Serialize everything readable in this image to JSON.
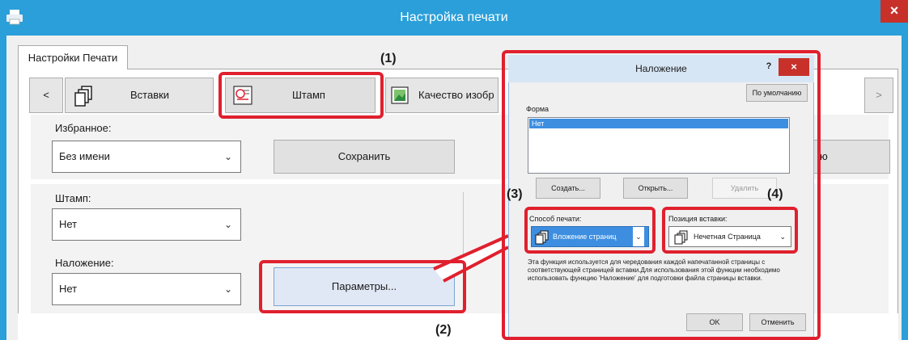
{
  "window": {
    "title": "Настройка печати",
    "close": "×"
  },
  "tab": {
    "label": "Настройки Печати"
  },
  "strip": {
    "prev": "<",
    "next": ">",
    "items": [
      {
        "label": "Вставки",
        "icon": "pages-stack-icon"
      },
      {
        "label": "Штамп",
        "icon": "stamp-icon"
      },
      {
        "label": "Качество изобр",
        "icon": "image-quality-icon"
      }
    ]
  },
  "favorites": {
    "label": "Избранное:",
    "value": "Без имени",
    "save": "Сохранить",
    "partial_button": "ю"
  },
  "stamp": {
    "label": "Штамп:",
    "value": "Нет"
  },
  "overlay": {
    "label": "Наложение:",
    "value": "Нет",
    "params": "Параметры..."
  },
  "dialog": {
    "title": "Наложение",
    "help": "?",
    "close": "×",
    "default": "По умолчанию",
    "form_label": "Форма",
    "form_items": [
      "Нет"
    ],
    "create": "Создать...",
    "open": "Открыть...",
    "delete": "Удалить",
    "print_method": {
      "label": "Способ печати:",
      "value": "Вложение страниц"
    },
    "insert_position": {
      "label": "Позиция вставки:",
      "value": "Нечетная Страница"
    },
    "description": "Эта функция используется для чередования каждой напечатанной страницы с соответствующей страницей вставки.Для использования этой функции необходимо использовать функцию 'Наложение' для подготовки файла страницы вставки.",
    "ok": "OK",
    "cancel": "Отменить"
  },
  "callouts": [
    "(1)",
    "(2)",
    "(3)",
    "(4)"
  ],
  "colors": {
    "titlebar": "#2b9fd9",
    "highlight": "#e0202e",
    "selection": "#3d8ee0"
  }
}
